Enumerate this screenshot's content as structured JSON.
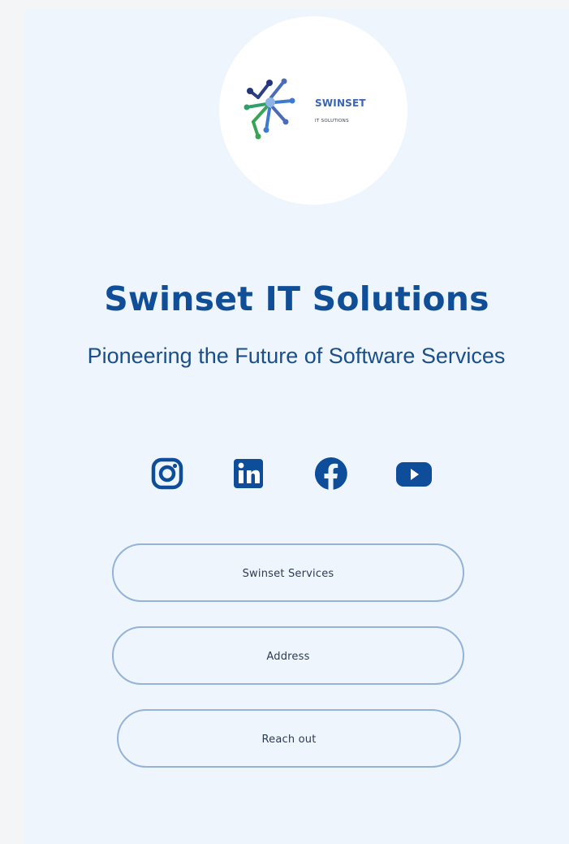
{
  "logo": {
    "wordmark": "SWINSET",
    "tagline": "IT SOLUTIONS"
  },
  "header": {
    "title": "Swinset IT Solutions",
    "subtitle": "Pioneering the Future of Software Services"
  },
  "social": [
    {
      "icon": "instagram-icon"
    },
    {
      "icon": "linkedin-icon"
    },
    {
      "icon": "facebook-icon"
    },
    {
      "icon": "youtube-icon"
    }
  ],
  "links": [
    {
      "label": "Swinset Services"
    },
    {
      "label": "Address"
    },
    {
      "label": "Reach out"
    }
  ],
  "colors": {
    "background": "#f4f5f7",
    "card": "#eef5fd",
    "title": "#104f97",
    "icon": "#0d4d99",
    "button_border": "#93b3d8"
  }
}
